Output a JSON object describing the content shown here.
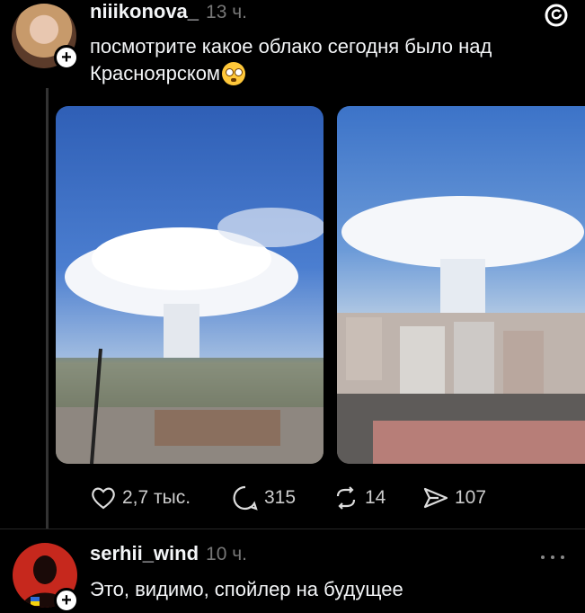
{
  "post": {
    "username": "niiikonova_",
    "time": "13 ч.",
    "text_line1": "посмотрите какое облако сегодня было над",
    "text_line2": "Красноярском",
    "emoji": "😳"
  },
  "actions": {
    "likes": "2,7 тыс.",
    "comments": "315",
    "reposts": "14",
    "shares": "107"
  },
  "reply": {
    "username": "serhii_wind",
    "time": "10 ч.",
    "text": "Это, видимо, спойлер на будущее"
  },
  "icons": {
    "brand": "threads-icon",
    "more": "more-dots-icon"
  }
}
